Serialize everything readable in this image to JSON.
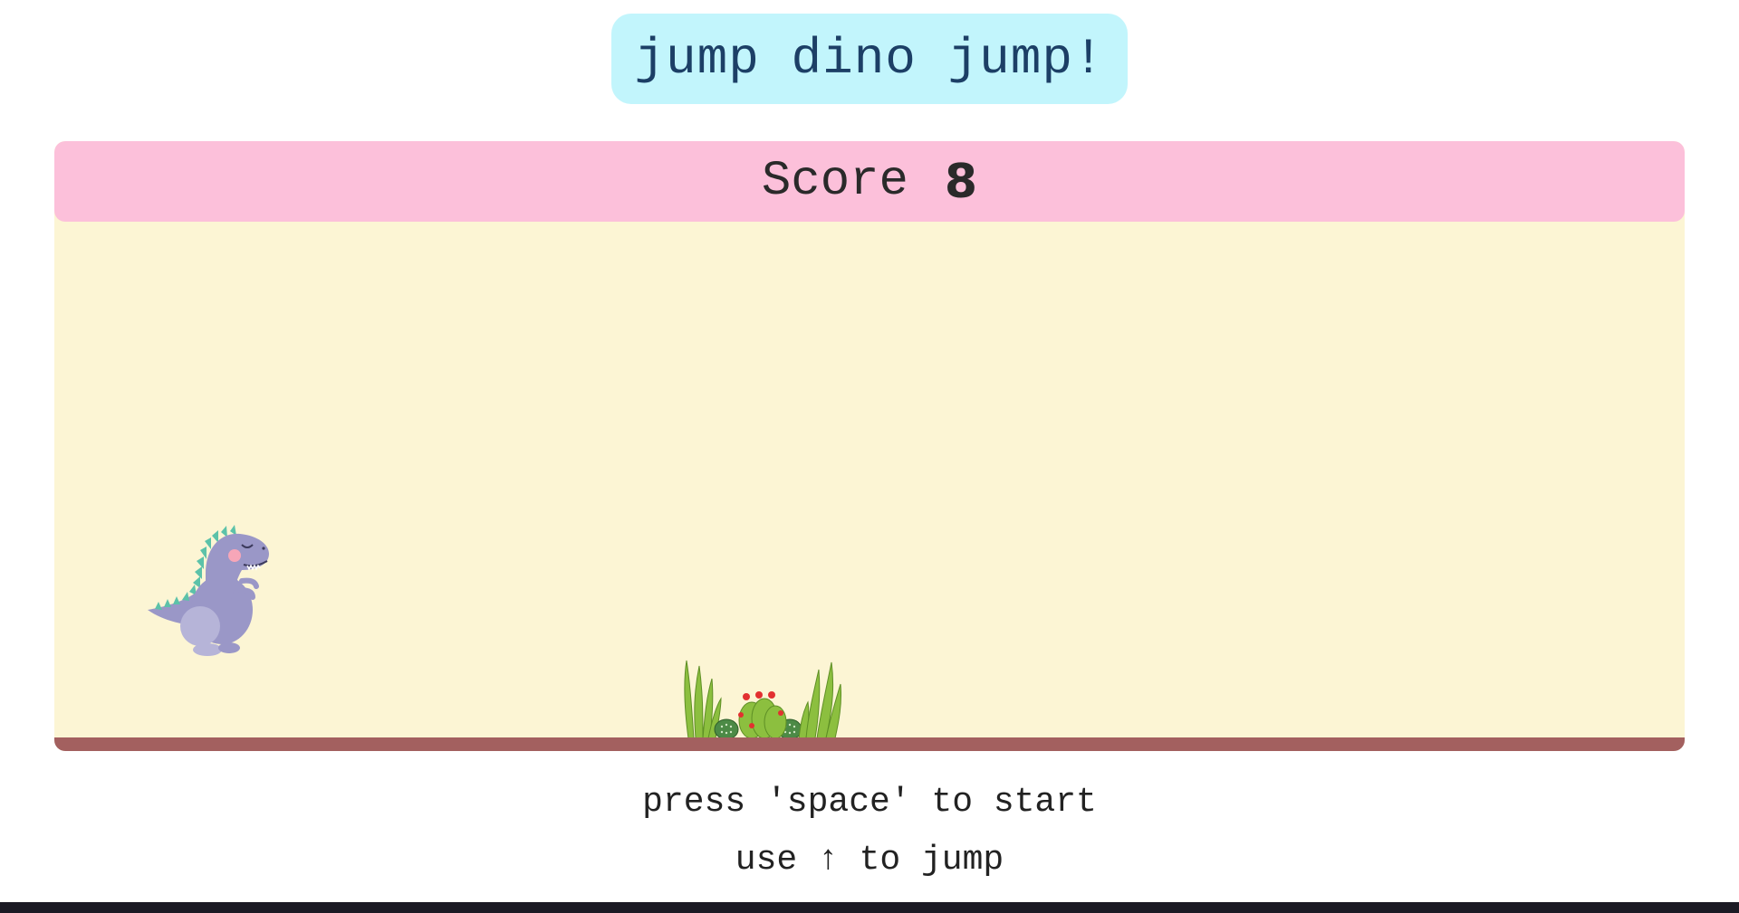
{
  "title": "jump dino jump!",
  "score": {
    "label": "Score",
    "value": "8"
  },
  "instructions": {
    "start": "press 'space' to start",
    "jump": "use ↑ to jump"
  },
  "sprites": {
    "player": "dinosaur",
    "obstacle": "cactus-cluster"
  },
  "colors": {
    "title_bg": "#c2f5fc",
    "title_text": "#1c3f66",
    "score_bg": "#fcc0da",
    "playfield_bg": "#fcf5d4",
    "ground": "#a3605f",
    "dino_body": "#9a97c7",
    "dino_spikes": "#5cc2a9",
    "cactus": "#7fb23b"
  }
}
